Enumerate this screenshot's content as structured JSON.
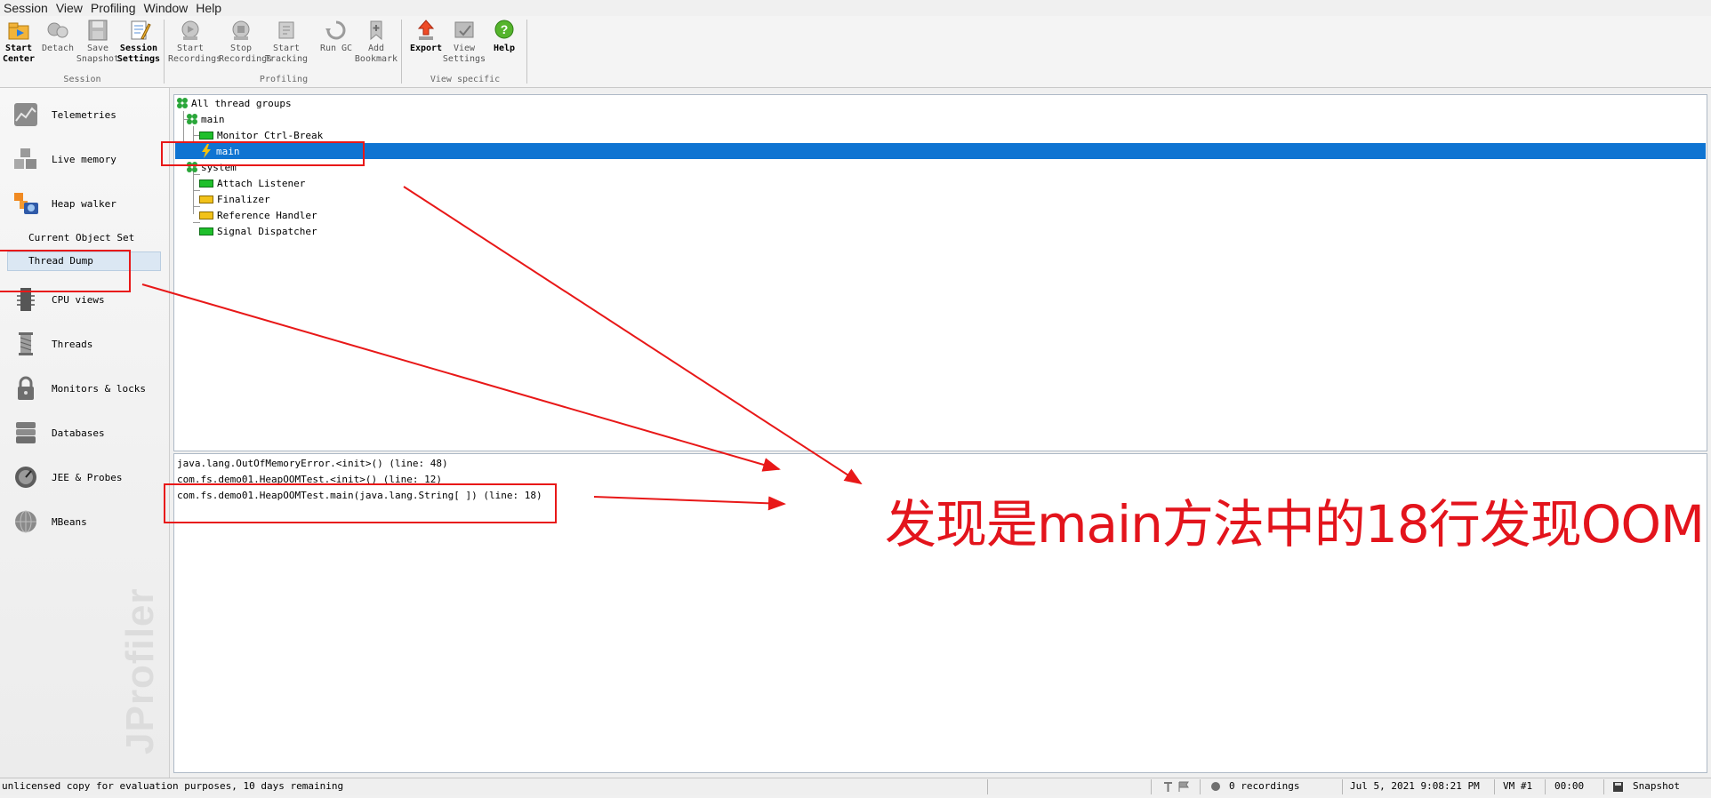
{
  "menu": [
    "Session",
    "View",
    "Profiling",
    "Window",
    "Help"
  ],
  "toolbar": {
    "groups": [
      {
        "title": "Session",
        "buttons": [
          {
            "label": "Start\nCenter",
            "icon": "start-center-icon",
            "strong": true
          },
          {
            "label": "Detach",
            "icon": "detach-icon",
            "strong": false
          },
          {
            "label": "Save\nSnapshot",
            "icon": "save-snapshot-icon",
            "strong": false
          },
          {
            "label": "Session\nSettings",
            "icon": "session-settings-icon",
            "strong": true
          }
        ]
      },
      {
        "title": "Profiling",
        "buttons": [
          {
            "label": "Start\nRecordings",
            "icon": "start-recordings-icon",
            "strong": false
          },
          {
            "label": "Stop\nRecordings",
            "icon": "stop-recordings-icon",
            "strong": false
          },
          {
            "label": "Start\nTracking",
            "icon": "start-tracking-icon",
            "strong": false
          },
          {
            "label": "Run GC",
            "icon": "run-gc-icon",
            "strong": false
          },
          {
            "label": "Add\nBookmark",
            "icon": "add-bookmark-icon",
            "strong": false
          }
        ]
      },
      {
        "title": "View specific",
        "buttons": [
          {
            "label": "Export",
            "icon": "export-icon",
            "strong": true
          },
          {
            "label": "View\nSettings",
            "icon": "view-settings-icon",
            "strong": false
          },
          {
            "label": "Help",
            "icon": "help-icon",
            "strong": true
          }
        ]
      }
    ]
  },
  "sidebar": {
    "items": [
      {
        "label": "Telemetries",
        "icon": "telemetries-icon"
      },
      {
        "label": "Live memory",
        "icon": "live-memory-icon"
      },
      {
        "label": "Heap walker",
        "icon": "heap-walker-icon"
      },
      {
        "label": "CPU views",
        "icon": "cpu-views-icon"
      },
      {
        "label": "Threads",
        "icon": "threads-icon"
      },
      {
        "label": "Monitors & locks",
        "icon": "monitors-locks-icon"
      },
      {
        "label": "Databases",
        "icon": "databases-icon"
      },
      {
        "label": "JEE & Probes",
        "icon": "jee-probes-icon"
      },
      {
        "label": "MBeans",
        "icon": "mbeans-icon"
      }
    ],
    "subitems": [
      {
        "label": "Current Object Set",
        "selected": false
      },
      {
        "label": "Thread Dump",
        "selected": true
      }
    ],
    "watermark": "JProfiler"
  },
  "thread_tree": {
    "root": "All thread groups",
    "groups": [
      {
        "name": "main",
        "threads": [
          {
            "name": "Monitor Ctrl-Break",
            "state": "running",
            "color": "#1fbf2b",
            "selected": false
          },
          {
            "name": "main",
            "state": "runnable",
            "color": "#f0c000",
            "selected": true
          }
        ]
      },
      {
        "name": "system",
        "threads": [
          {
            "name": "Attach Listener",
            "state": "running",
            "color": "#1fbf2b",
            "selected": false
          },
          {
            "name": "Finalizer",
            "state": "waiting",
            "color": "#f2c21a",
            "selected": false
          },
          {
            "name": "Reference Handler",
            "state": "waiting",
            "color": "#f2c21a",
            "selected": false
          },
          {
            "name": "Signal Dispatcher",
            "state": "running",
            "color": "#1fbf2b",
            "selected": false
          }
        ]
      }
    ]
  },
  "stack_trace": [
    "java.lang.OutOfMemoryError.<init>() (line: 48)",
    "com.fs.demo01.HeapOOMTest.<init>() (line: 12)",
    "com.fs.demo01.HeapOOMTest.main(java.lang.String[ ]) (line: 18)"
  ],
  "annotation_text": "发现是main方法中的18行发现OOM",
  "status_bar": {
    "license": "unlicensed copy for evaluation purposes, 10 days remaining",
    "recordings": "0 recordings",
    "datetime": "Jul 5, 2021 9:08:21 PM",
    "vm": "VM #1",
    "elapsed": "00:00",
    "mode": "Snapshot"
  },
  "colors": {
    "selection": "#0f74d2",
    "annotation": "#e3141c",
    "running": "#1fbf2b",
    "waiting": "#f2c21a"
  }
}
